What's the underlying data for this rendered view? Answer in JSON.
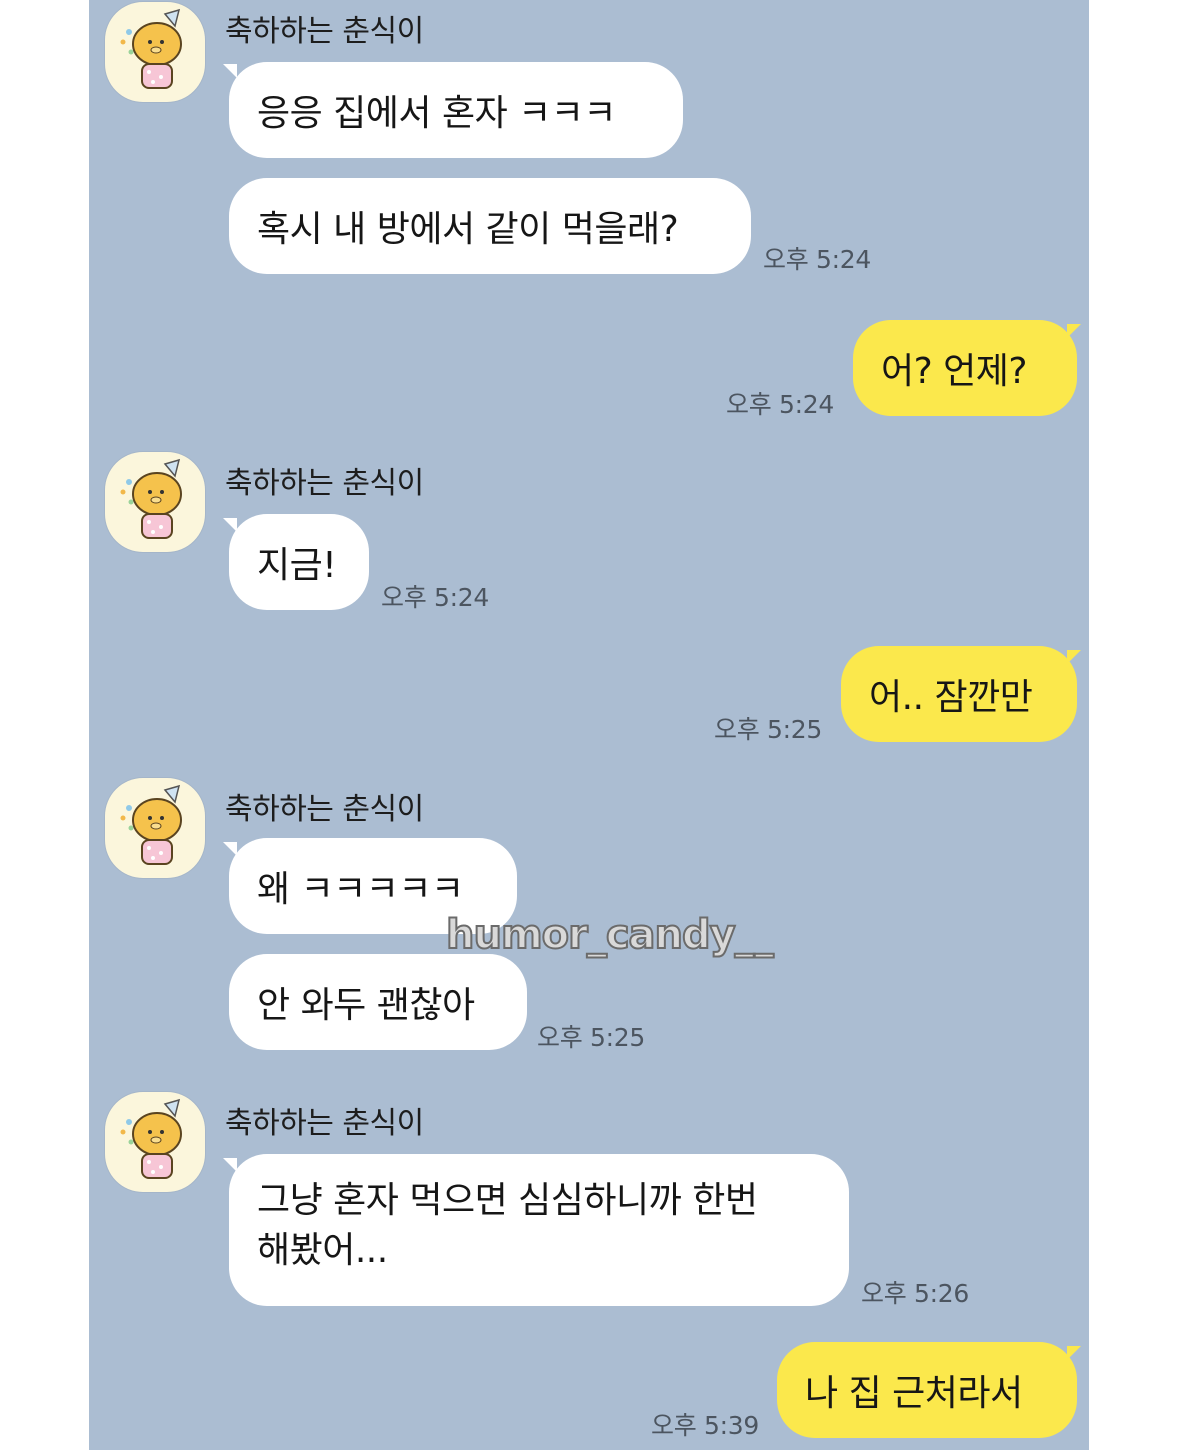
{
  "chat": {
    "background_color": "#abbdd2",
    "my_bubble_color": "#fbe84c",
    "their_bubble_color": "#ffffff",
    "sender_name": "축하하는 춘식이",
    "avatar_icon": "choonsik-party-hat-avatar",
    "messages": [
      {
        "text": "응응 집에서 혼자 ㅋㅋㅋ"
      },
      {
        "text": "혹시 내 방에서 같이 먹을래?",
        "time": "오후 5:24"
      },
      {
        "text": "어? 언제?",
        "time": "오후 5:24"
      },
      {
        "text": "지금!",
        "time": "오후 5:24"
      },
      {
        "text": "어.. 잠깐만",
        "time": "오후 5:25"
      },
      {
        "text": "왜 ㅋㅋㅋㅋㅋ"
      },
      {
        "text": "안 와두 괜찮아",
        "time": "오후 5:25"
      },
      {
        "line1": "그냥 혼자 먹으면 심심하니까 한번",
        "line2": "해봤어...",
        "time": "오후 5:26"
      },
      {
        "text": "나 집 근처라서",
        "time": "오후 5:39"
      }
    ]
  },
  "watermark": "humor_candy__"
}
